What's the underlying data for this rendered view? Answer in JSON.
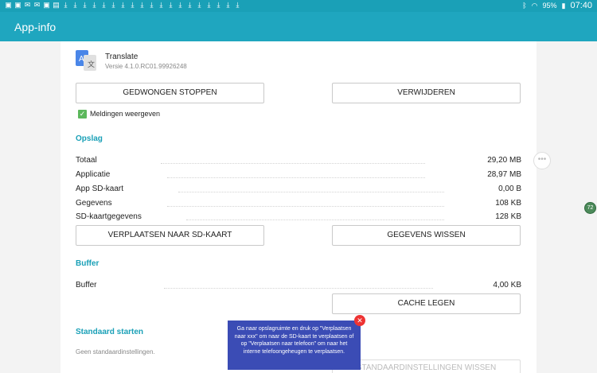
{
  "status_bar": {
    "battery": "95%",
    "time": "07:40"
  },
  "app_bar": {
    "title": "App-info"
  },
  "app": {
    "name": "Translate",
    "version": "Versie 4.1.0.RC01.99926248"
  },
  "actions": {
    "force_stop": "GEDWONGEN STOPPEN",
    "uninstall": "VERWIJDEREN"
  },
  "notifications": {
    "label": "Meldingen weergeven",
    "checked": true
  },
  "storage": {
    "title": "Opslag",
    "rows": [
      {
        "label": "Totaal",
        "value": "29,20 MB"
      },
      {
        "label": "Applicatie",
        "value": "28,97 MB"
      },
      {
        "label": "App SD-kaart",
        "value": "0,00 B"
      },
      {
        "label": "Gegevens",
        "value": "108 KB"
      },
      {
        "label": "SD-kaartgegevens",
        "value": "128 KB"
      }
    ],
    "move_sd": "VERPLAATSEN NAAR SD-KAART",
    "clear_data": "GEGEVENS WISSEN"
  },
  "cache": {
    "title": "Buffer",
    "label": "Buffer",
    "value": "4,00 KB",
    "clear": "CACHE LEGEN"
  },
  "defaults": {
    "title": "Standaard starten",
    "none": "Geen standaardinstellingen.",
    "clear": "STANDAARDINSTELLINGEN WISSEN"
  },
  "tooltip": {
    "text": "Ga naar opslagruimte en druk op \"Verplaatsen naar xxx\" om naar de SD-kaart te verplaatsen of op \"Verplaatsen naar telefoon\" om naar het interne telefoongeheugen te verplaatsen."
  },
  "side_badge": "72"
}
